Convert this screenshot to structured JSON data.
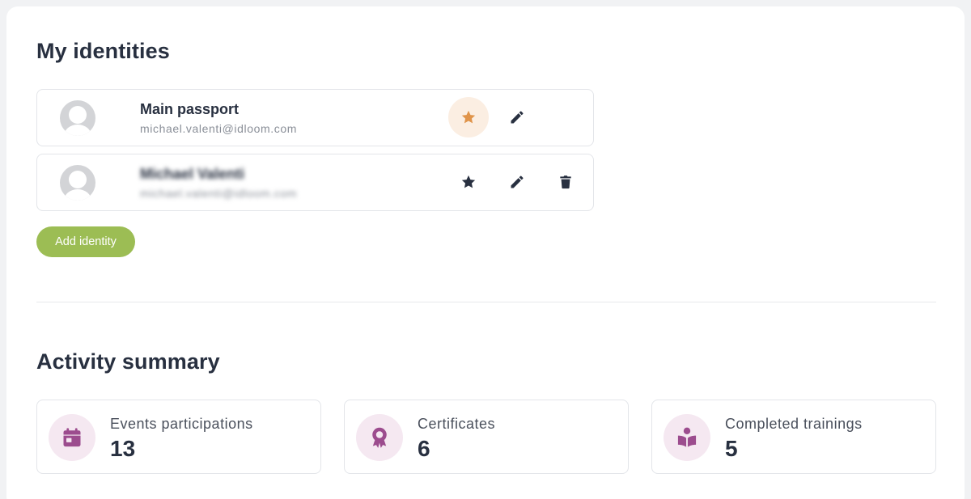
{
  "identities_section": {
    "title": "My identities",
    "identities": [
      {
        "name": "Main passport",
        "email": "michael.valenti@idloom.com",
        "is_default": true,
        "can_delete": false
      },
      {
        "name": "Michael Valenti",
        "email": "michael.valenti@idloom.com",
        "is_default": false,
        "can_delete": true
      }
    ],
    "add_button_label": "Add identity"
  },
  "activity_section": {
    "title": "Activity summary",
    "stats": [
      {
        "label": "Events participations",
        "value": "13",
        "icon": "calendar-icon"
      },
      {
        "label": "Certificates",
        "value": "6",
        "icon": "award-icon"
      },
      {
        "label": "Completed trainings",
        "value": "5",
        "icon": "book-reader-icon"
      }
    ]
  },
  "colors": {
    "accent_green": "#9cbd54",
    "default_star": "#e0944a",
    "default_star_bg": "#fbeee2",
    "stat_icon": "#9c4c8e",
    "stat_icon_bg": "#f5e8f1",
    "text_dark": "#283040"
  }
}
